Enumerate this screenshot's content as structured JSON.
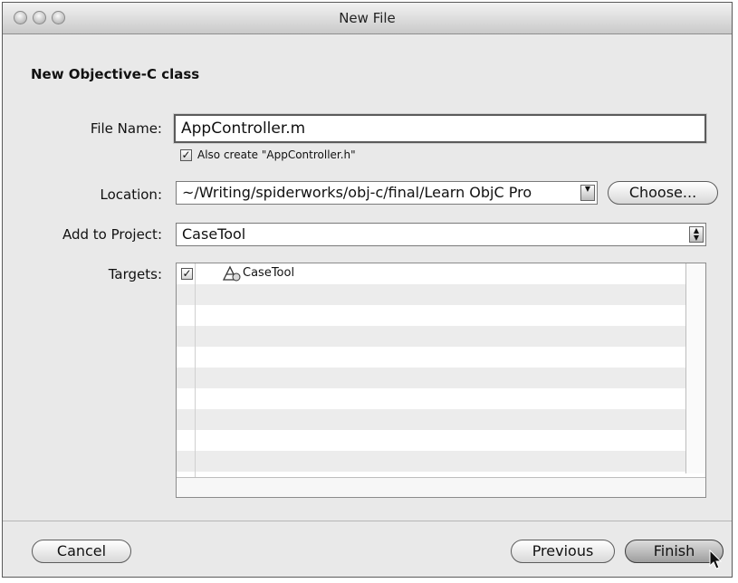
{
  "window": {
    "title": "New File"
  },
  "heading": "New Objective-C class",
  "form": {
    "file_name_label": "File Name:",
    "file_name_value": "AppController.m",
    "also_create_label": "Also create \"AppController.h\"",
    "also_create_checked": true,
    "location_label": "Location:",
    "location_value": "~/Writing/spiderworks/obj-c/final/Learn ObjC Pro",
    "choose_label": "Choose...",
    "project_label": "Add to Project:",
    "project_value": "CaseTool",
    "targets_label": "Targets:"
  },
  "targets": [
    {
      "name": "CaseTool",
      "checked": true,
      "icon": "target-app-icon"
    }
  ],
  "buttons": {
    "cancel": "Cancel",
    "previous": "Previous",
    "finish": "Finish"
  },
  "colors": {
    "window_bg": "#e9e9e9",
    "titlebar_top": "#f2f2f2",
    "titlebar_bottom": "#c9c9c9",
    "row_alt": "#ececec"
  }
}
